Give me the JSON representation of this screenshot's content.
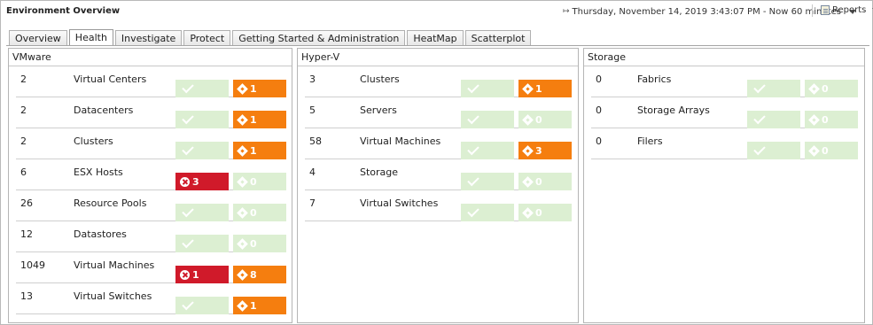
{
  "app": {
    "title": "Environment Overview",
    "time_range": "Thursday, November 14, 2019 3:43:07 PM - Now 60 minutes",
    "reports_label": "Reports"
  },
  "tabs": [
    {
      "label": "Overview",
      "active": false
    },
    {
      "label": "Health",
      "active": true
    },
    {
      "label": "Investigate",
      "active": false
    },
    {
      "label": "Protect",
      "active": false
    },
    {
      "label": "Getting Started & Administration",
      "active": false
    },
    {
      "label": "HeatMap",
      "active": false
    },
    {
      "label": "Scatterplot",
      "active": false
    }
  ],
  "colors": {
    "ok": "#dcefd2",
    "warning": "#f57e0f",
    "critical": "#d01a2a"
  },
  "panels": {
    "vmware": {
      "title": "VMware",
      "rows": [
        {
          "count": "2",
          "label": "Virtual Centers",
          "first": {
            "type": "ok"
          },
          "second": {
            "type": "warn",
            "value": "1"
          }
        },
        {
          "count": "2",
          "label": "Datacenters",
          "first": {
            "type": "ok"
          },
          "second": {
            "type": "warn",
            "value": "1"
          }
        },
        {
          "count": "2",
          "label": "Clusters",
          "first": {
            "type": "ok"
          },
          "second": {
            "type": "warn",
            "value": "1"
          }
        },
        {
          "count": "6",
          "label": "ESX Hosts",
          "first": {
            "type": "crit",
            "value": "3"
          },
          "second": {
            "type": "warn-empty",
            "value": "0"
          }
        },
        {
          "count": "26",
          "label": "Resource Pools",
          "first": {
            "type": "ok"
          },
          "second": {
            "type": "warn-empty",
            "value": "0"
          }
        },
        {
          "count": "12",
          "label": "Datastores",
          "first": {
            "type": "ok"
          },
          "second": {
            "type": "warn-empty",
            "value": "0"
          }
        },
        {
          "count": "1049",
          "label": "Virtual Machines",
          "first": {
            "type": "crit",
            "value": "1"
          },
          "second": {
            "type": "warn",
            "value": "8"
          }
        },
        {
          "count": "13",
          "label": "Virtual Switches",
          "first": {
            "type": "ok"
          },
          "second": {
            "type": "warn",
            "value": "1"
          }
        }
      ]
    },
    "hyperv": {
      "title": "Hyper-V",
      "rows": [
        {
          "count": "3",
          "label": "Clusters",
          "first": {
            "type": "ok"
          },
          "second": {
            "type": "warn",
            "value": "1"
          }
        },
        {
          "count": "5",
          "label": "Servers",
          "first": {
            "type": "ok"
          },
          "second": {
            "type": "warn-empty",
            "value": "0"
          }
        },
        {
          "count": "58",
          "label": "Virtual Machines",
          "first": {
            "type": "ok"
          },
          "second": {
            "type": "warn",
            "value": "3"
          }
        },
        {
          "count": "4",
          "label": "Storage",
          "first": {
            "type": "ok"
          },
          "second": {
            "type": "warn-empty",
            "value": "0"
          }
        },
        {
          "count": "7",
          "label": "Virtual Switches",
          "first": {
            "type": "ok"
          },
          "second": {
            "type": "warn-empty",
            "value": "0"
          }
        }
      ]
    },
    "storage": {
      "title": "Storage",
      "rows": [
        {
          "count": "0",
          "label": "Fabrics",
          "first": {
            "type": "ok"
          },
          "second": {
            "type": "warn-empty",
            "value": "0"
          }
        },
        {
          "count": "0",
          "label": "Storage Arrays",
          "first": {
            "type": "ok"
          },
          "second": {
            "type": "warn-empty",
            "value": "0"
          }
        },
        {
          "count": "0",
          "label": "Filers",
          "first": {
            "type": "ok"
          },
          "second": {
            "type": "warn-empty",
            "value": "0"
          }
        }
      ]
    }
  }
}
